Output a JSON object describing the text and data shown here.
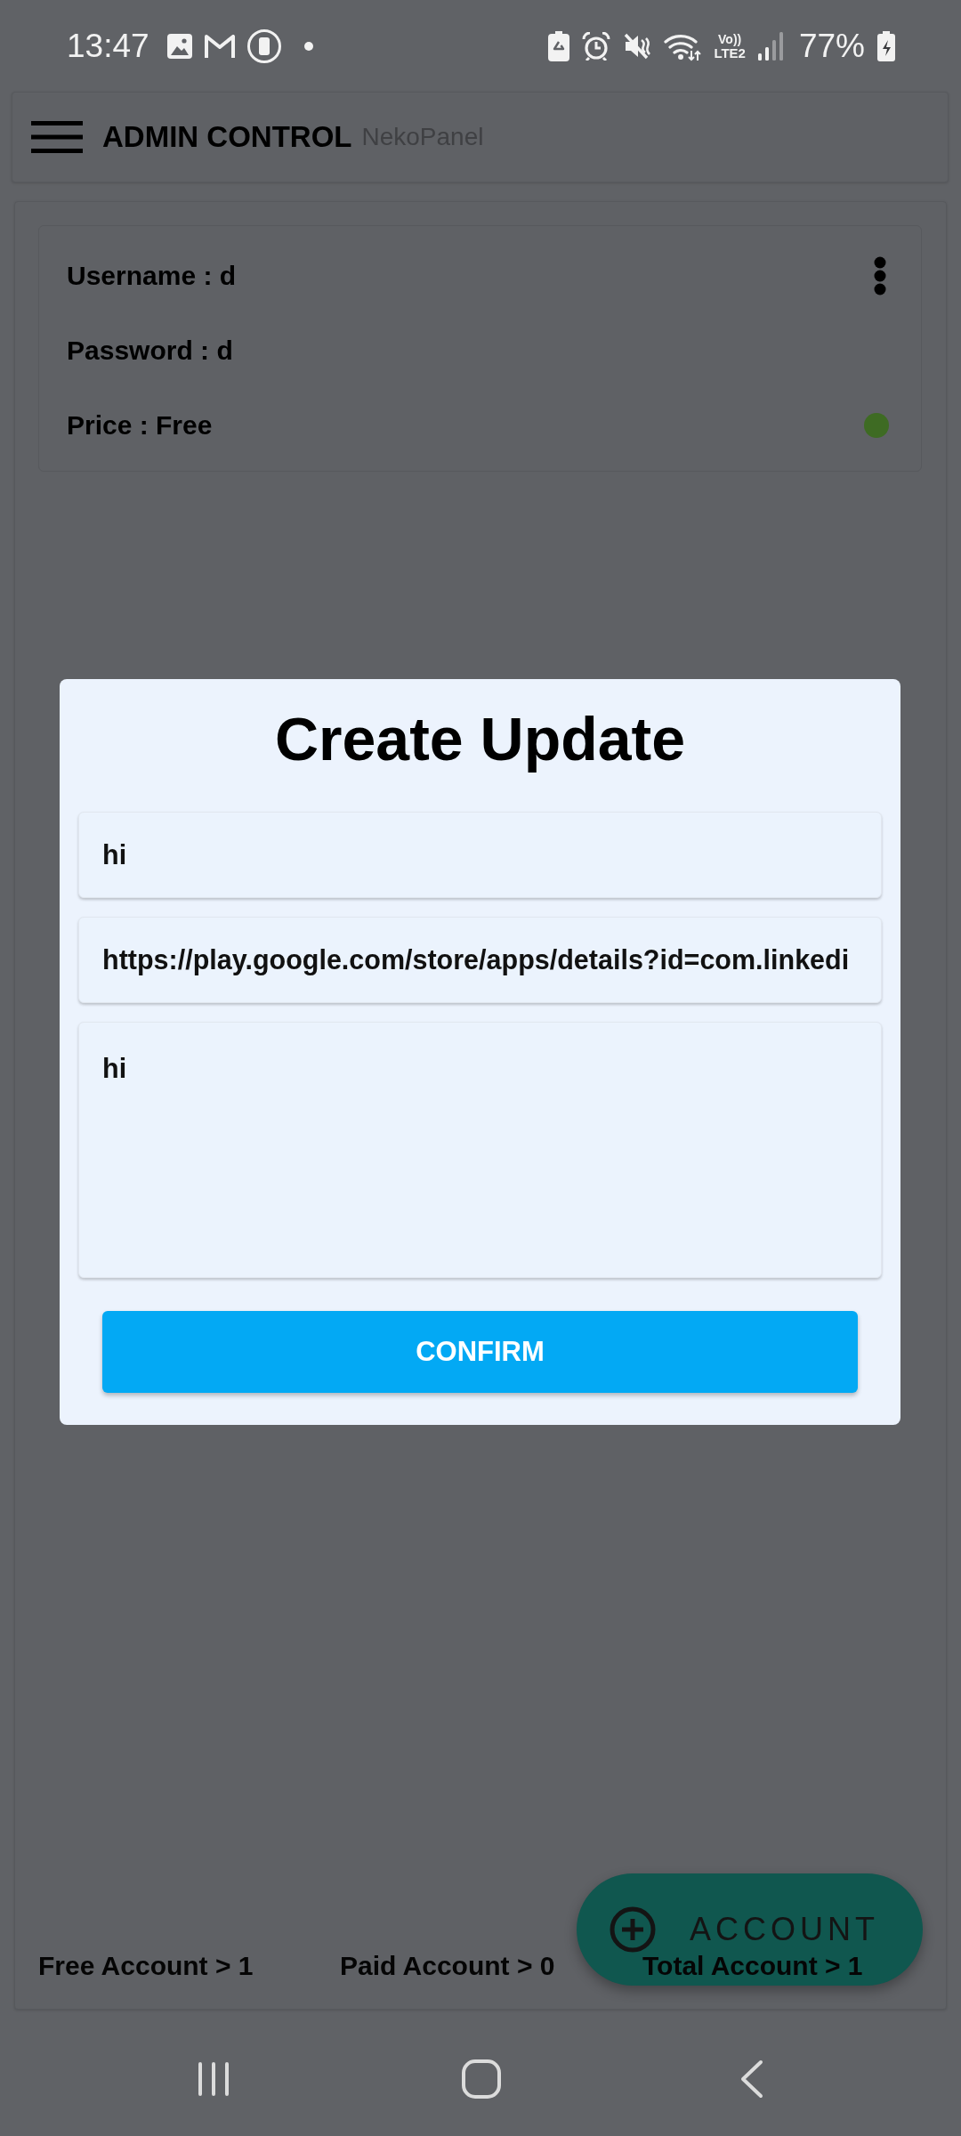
{
  "status_bar": {
    "time": "13:47",
    "volte": "Vo))",
    "network": "LTE2",
    "battery": "77%"
  },
  "app_bar": {
    "title": "ADMIN CONTROL",
    "subtitle": "NekoPanel"
  },
  "accounts": [
    {
      "lines": [
        "Username : d",
        "Password : d",
        "Price : Free"
      ],
      "color": "#3e6b23"
    }
  ],
  "footer": {
    "stats": [
      "Free Account > 1",
      "Paid Account > 0",
      "Total Account > 1"
    ]
  },
  "fab": {
    "label": "ACCOUNT"
  },
  "dialog": {
    "title": "Create Update",
    "fields": [
      {
        "kind": "line",
        "value": "hi"
      },
      {
        "kind": "line",
        "value": "https://play.google.com/store/apps/details?id=com.linkedi"
      },
      {
        "kind": "multiline",
        "value": "hi"
      }
    ],
    "button": "CONFIRM"
  }
}
